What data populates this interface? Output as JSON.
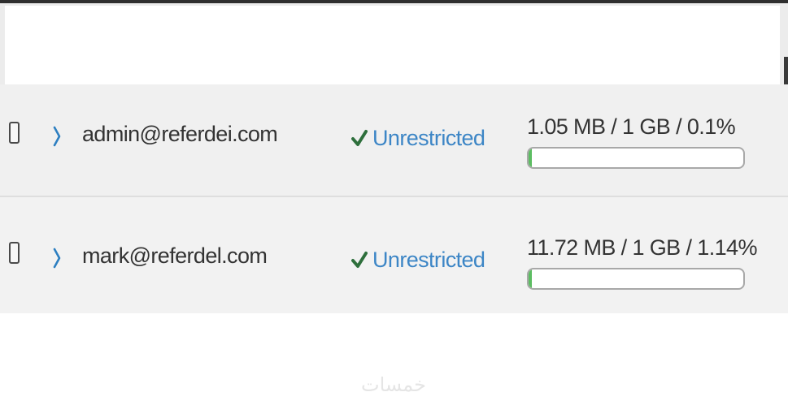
{
  "rows": [
    {
      "email": "admin@referdei.com",
      "status": "Unrestricted",
      "usage_text": "1.05 MB / 1 GB / 0.1%",
      "usage_fraction": 0.001
    },
    {
      "email": "mark@referdel.com",
      "status": "Unrestricted",
      "usage_text": "11.72 MB / 1 GB / 1.14%",
      "usage_fraction": 0.0114
    }
  ],
  "colors": {
    "accent": "#3d86c6",
    "success": "#2e6f3c",
    "progress": "#5cbd62"
  },
  "icons": {
    "checkbox": "checkbox-icon",
    "expand": "chevron-right-icon",
    "status": "checkmark-icon"
  },
  "watermark": "خمسات"
}
